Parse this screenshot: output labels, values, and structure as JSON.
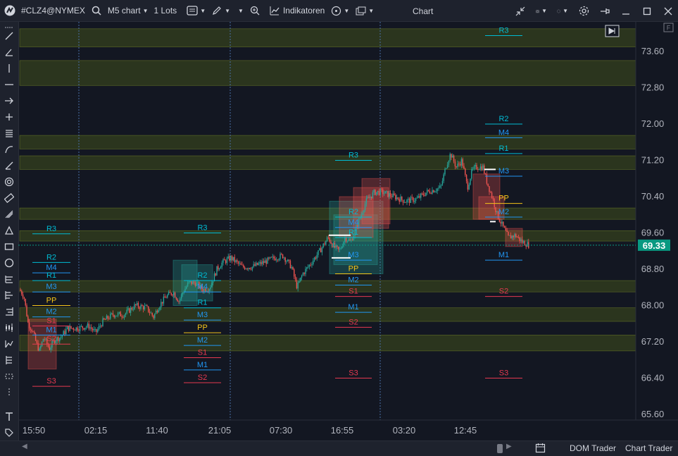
{
  "toolbar": {
    "symbol": "#CLZ4@NYMEX",
    "timeframe": "M5 chart",
    "lots": "1 Lots",
    "indicators_label": "Indikatoren",
    "title": "Chart"
  },
  "chart": {
    "current_price": "69.33",
    "price_labels": [
      "73.60",
      "72.80",
      "72.00",
      "71.20",
      "70.40",
      "69.60",
      "68.80",
      "68.00",
      "67.20",
      "66.40",
      "65.60"
    ],
    "time_labels": [
      "15:50",
      "02:15",
      "11:40",
      "21:05",
      "07:30",
      "16:55",
      "03:20",
      "12:45"
    ],
    "f_label": "F",
    "pivot_levels": [
      "R3",
      "R2",
      "M4",
      "R1",
      "M3",
      "PP",
      "M2",
      "S1",
      "M1",
      "S2",
      "S3"
    ]
  },
  "bottom": {
    "dom_trader": "DOM Trader",
    "chart_trader": "Chart Trader"
  },
  "colors": {
    "background": "#131722",
    "panel": "#1e222d",
    "up": "#26a69a",
    "down": "#ef5350",
    "resistance": "#00bcd4",
    "pivot": "#f5c518",
    "mid": "#2196f3",
    "support": "#e53950",
    "zone": "#4a5a1a",
    "price_tag": "#089981"
  }
}
